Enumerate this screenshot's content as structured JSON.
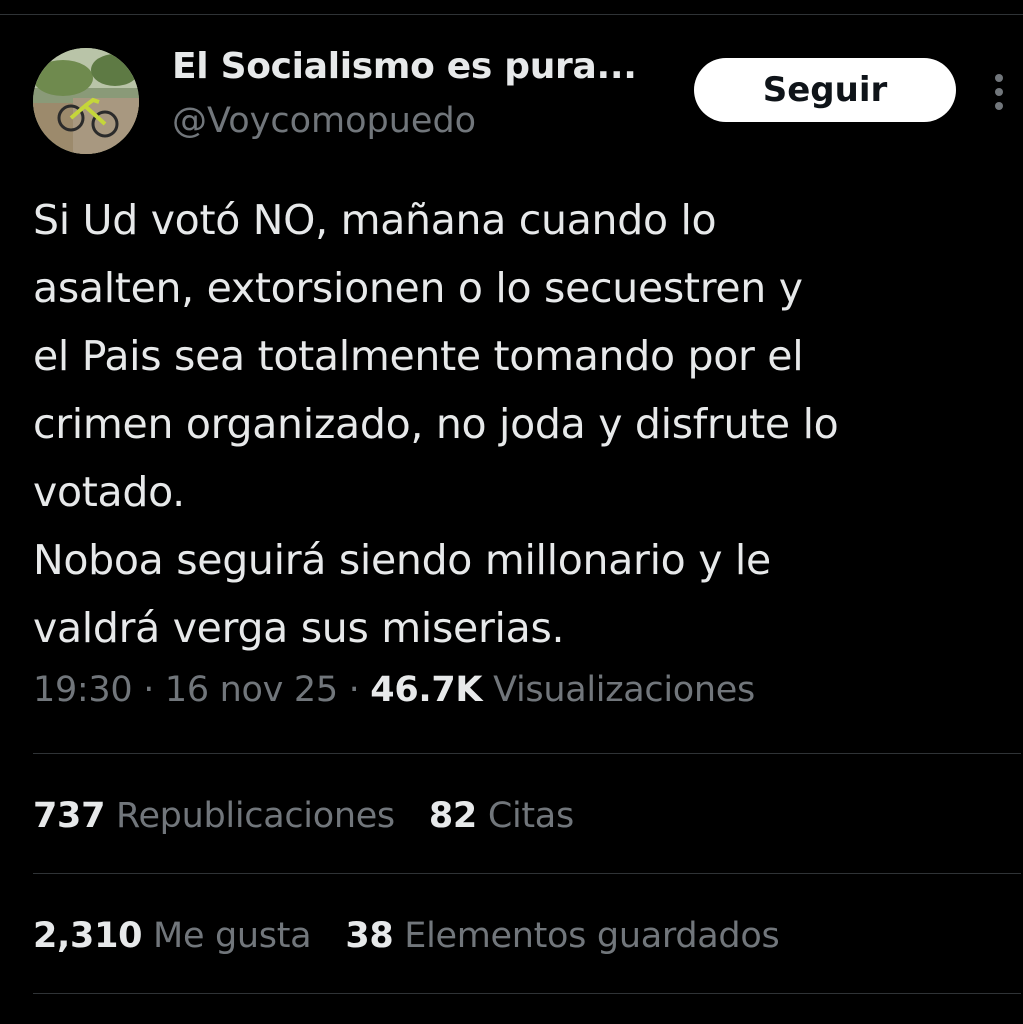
{
  "author": {
    "display_name": "El Socialismo es pura...",
    "handle": "@Voycomopuedo",
    "avatar_icon": "avatar-photo-bicycle"
  },
  "follow_button": {
    "label": "Seguir"
  },
  "more_icon": "more-vertical-icon",
  "tweet": {
    "text": "Si Ud votó NO, mañana cuando lo\nasalten, extorsionen o lo secuestren y\nel Pais sea totalmente tomando por el\ncrimen organizado, no joda y disfrute lo\nvotado.\nNoboa seguirá siendo millonario y le\nvaldrá verga sus miserias.",
    "time": "19:30",
    "separator": "·",
    "date": "16 nov 25",
    "views_count": "46.7K",
    "views_label": "Visualizaciones"
  },
  "stats": {
    "reposts": {
      "count": "737",
      "label": "Republicaciones"
    },
    "quotes": {
      "count": "82",
      "label": "Citas"
    },
    "likes": {
      "count": "2,310",
      "label": "Me gusta"
    },
    "bookmarks": {
      "count": "38",
      "label": "Elementos guardados"
    }
  },
  "colors": {
    "background": "#000000",
    "primary_text": "#e7e9ea",
    "secondary_text": "#71767b",
    "divider": "#2f3336",
    "follow_bg": "#ffffff"
  }
}
